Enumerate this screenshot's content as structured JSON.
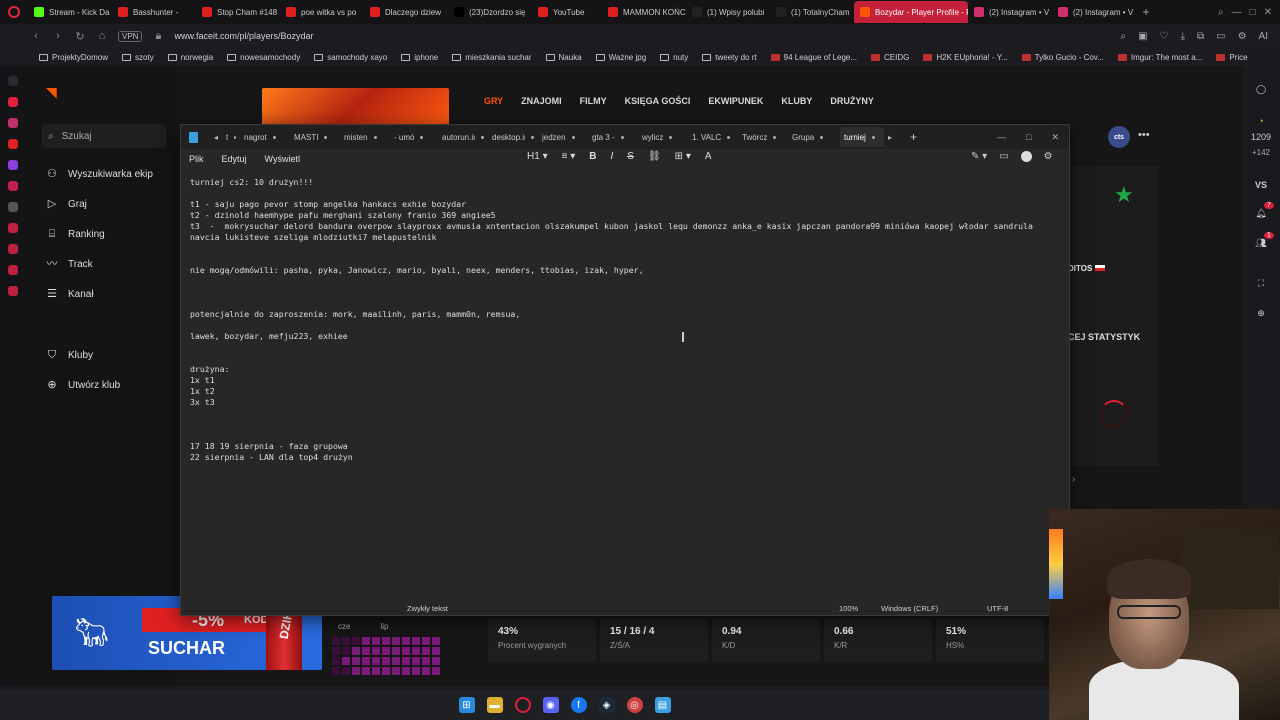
{
  "browser": {
    "tabs": [
      {
        "label": "Stream - Kick Da",
        "color": "#53fc18"
      },
      {
        "label": "Basshunter -",
        "color": "#e02020"
      },
      {
        "label": "Stop Cham #148",
        "color": "#e02020"
      },
      {
        "label": "poe witka vs po",
        "color": "#e02020"
      },
      {
        "label": "Dlaczego dziew",
        "color": "#e02020"
      },
      {
        "label": "(23)Dzordzo się",
        "color": "#000000"
      },
      {
        "label": "YouTube",
        "color": "#e02020"
      },
      {
        "label": "MAMMON KOŃC",
        "color": "#e02020"
      },
      {
        "label": "(1) Wpisy polubi",
        "color": "#222222"
      },
      {
        "label": "(1) TotalnyCham",
        "color": "#222222"
      },
      {
        "label": "Bozydar - Player Profile - F",
        "color": "#ff5500",
        "active": true
      },
      {
        "label": "(2) Instagram • V",
        "color": "#d0306a"
      },
      {
        "label": "(2) Instagram • V",
        "color": "#d0306a"
      }
    ],
    "vpn": "VPN",
    "url": "www.faceit.com/pl/players/Bozydar",
    "addr_right": "AI",
    "bookmarks": [
      {
        "label": "ProjektyDomow",
        "type": "folder"
      },
      {
        "label": "szoty",
        "type": "folder"
      },
      {
        "label": "norwegia",
        "type": "folder"
      },
      {
        "label": "nowesamochody",
        "type": "folder"
      },
      {
        "label": "samochody xayo",
        "type": "folder"
      },
      {
        "label": "iphone",
        "type": "folder"
      },
      {
        "label": "mieszkania suchar",
        "type": "folder"
      },
      {
        "label": "Nauka",
        "type": "folder"
      },
      {
        "label": "Ważne jpg",
        "type": "folder"
      },
      {
        "label": "nuty",
        "type": "folder"
      },
      {
        "label": "tweety do rt",
        "type": "folder"
      },
      {
        "label": "94 League of Lege...",
        "type": "site"
      },
      {
        "label": "CEIDG",
        "type": "site"
      },
      {
        "label": "H2K EUphoria! - Y...",
        "type": "site"
      },
      {
        "label": "Tylko Gucio - Cov...",
        "type": "site"
      },
      {
        "label": "Imgur: The most a...",
        "type": "site"
      },
      {
        "label": "Price history, price...",
        "type": "site"
      }
    ]
  },
  "faceit": {
    "search": "Szukaj",
    "nav": [
      {
        "label": "Wyszukiwarka ekip",
        "icon": "users-icon"
      },
      {
        "label": "Graj",
        "icon": "play-icon"
      },
      {
        "label": "Ranking",
        "icon": "ranking-icon"
      },
      {
        "label": "Track",
        "icon": "chart-icon"
      },
      {
        "label": "Kanał",
        "icon": "feed-icon"
      },
      {
        "label": "Kluby",
        "icon": "club-icon"
      },
      {
        "label": "Utwórz klub",
        "icon": "plus-circle-icon"
      }
    ],
    "topnav": [
      "GRY",
      "ZNAJOMI",
      "FILMY",
      "KSIĘGA GOŚCI",
      "EKWIPUNEK",
      "KLUBY",
      "DRUŻYNY"
    ],
    "cts": "cts",
    "ditos": "DITOS",
    "stats_title": "CEJ STATYSTYK",
    "heat_labels": [
      "cze",
      "lip"
    ],
    "stats": [
      {
        "value": "43%",
        "label": "Procent wygranych"
      },
      {
        "value": "15 / 16 / 4",
        "label": "Z/Ś/A"
      },
      {
        "value": "0.94",
        "label": "K/D"
      },
      {
        "value": "0.66",
        "label": "K/R"
      },
      {
        "value": "51%",
        "label": "HS%"
      }
    ]
  },
  "promo": {
    "discount": "-5%",
    "kod": "KOD",
    "code": "SUCHAR",
    "brand": "DZIK"
  },
  "notepad": {
    "tabs": [
      "t",
      "nagrot",
      "MASTI",
      "misten",
      "- umó",
      "autorun.inf",
      "desktop.ini",
      "jedzen",
      "gta 3 -",
      "wylicz",
      "1. VALC",
      "Twórcz",
      "Grupa",
      "turniej"
    ],
    "menu": [
      "Plik",
      "Edytuj",
      "Wyświetl"
    ],
    "format": [
      "H1",
      "≡",
      "B",
      "I",
      "S",
      "⛓",
      "⊞",
      "A"
    ],
    "lines": [
      "turniej cs2: 10 drużyn!!!",
      "",
      "t1 - saju pago pevor stomp angelka hankacs exhie bozydar",
      "t2 - dzinold haemhype pafu merghani szalony franio 369 angiee5",
      "t3  -  mokrysuchar delord bandura overpow slayproxx avmusia xntentacion olszakumpel kubon jaskol lequ demonzz anka_e kasix japczan pandora99 miniówa kaopej włodar sandrula",
      "navcia lukisteve szeliga mlodziutki7 melapustelnik",
      "",
      "",
      "nie mogą/odmówili: pasha, pyka, Janowicz, mario, byali, neex, menders, ttobias, izak, hyper,",
      "",
      "",
      "",
      "potencjalnie do zaproszenia: mork, maailinh, paris, mamm0n, remsua,",
      "",
      "lawek, bozydar, mefju223, exhiee",
      "",
      "",
      "drużyna:",
      "1x t1",
      "1x t2",
      "3x t3",
      "",
      "",
      "",
      "17 18 19 sierpnia - faza grupowa",
      "22 sierpnia - LAN dla top4 drużyn"
    ],
    "status": {
      "style": "Zwykły tekst",
      "zoom": "100%",
      "eol": "Windows (CRLF)",
      "encoding": "UTF-8"
    }
  },
  "right_sidebar": {
    "count1": "1209",
    "count2": "+142",
    "vs": "VS",
    "badge1": "7",
    "badge2": "1"
  }
}
